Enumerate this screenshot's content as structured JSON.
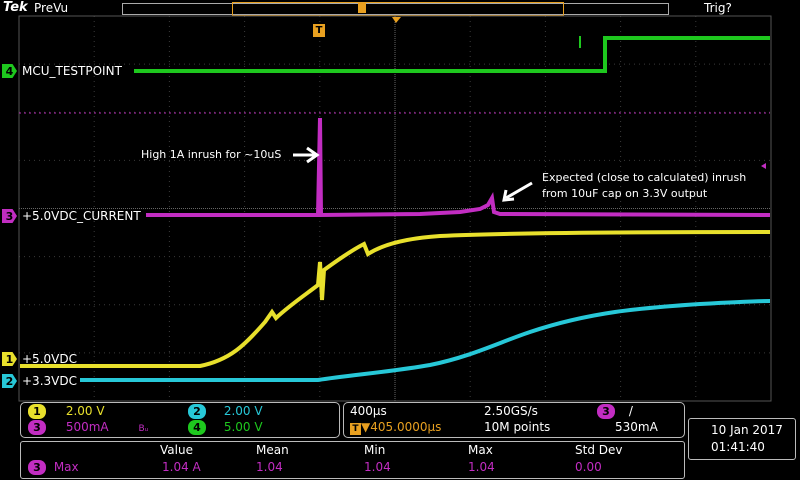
{
  "topbar": {
    "brand": "Tek",
    "status": "PreVu",
    "trigger_status": "Trig?"
  },
  "trigger_marker": "T",
  "channels": [
    {
      "id": "1",
      "name": "+5.0VDC",
      "color": "#e8e02c",
      "scale": "2.00 V"
    },
    {
      "id": "2",
      "name": "+3.3VDC",
      "color": "#27c8d8",
      "scale": "2.00 V"
    },
    {
      "id": "3",
      "name": "+5.0VDC_CURRENT",
      "color": "#c22dc2",
      "scale": "500mA",
      "bw_symbol": "Bᵤ"
    },
    {
      "id": "4",
      "name": "MCU_TESTPOINT",
      "color": "#1ec81e",
      "scale": "5.00 V"
    }
  ],
  "annotations": {
    "inrush": "High 1A inrush for ~10uS",
    "expected_line1": "Expected (close to calculated) inrush",
    "expected_line2": "from 10uF cap on 3.3V output"
  },
  "timebase": {
    "horizontal_scale": "400µs",
    "trigger_position": "▼405.0000µs",
    "sample_rate": "2.50GS/s",
    "record_length": "10M points",
    "trigger_source": "3",
    "trigger_slope": "/",
    "trigger_level": "530mA"
  },
  "datetime": {
    "date": "10 Jan  2017",
    "time": "01:41:40"
  },
  "measurements": {
    "headers": [
      "Value",
      "Mean",
      "Min",
      "Max",
      "Std Dev"
    ],
    "rows": [
      {
        "channel": "3",
        "label": "Max",
        "value": "1.04 A",
        "mean": "1.04",
        "min": "1.04",
        "max": "1.04",
        "std_dev": "0.00"
      }
    ]
  }
}
